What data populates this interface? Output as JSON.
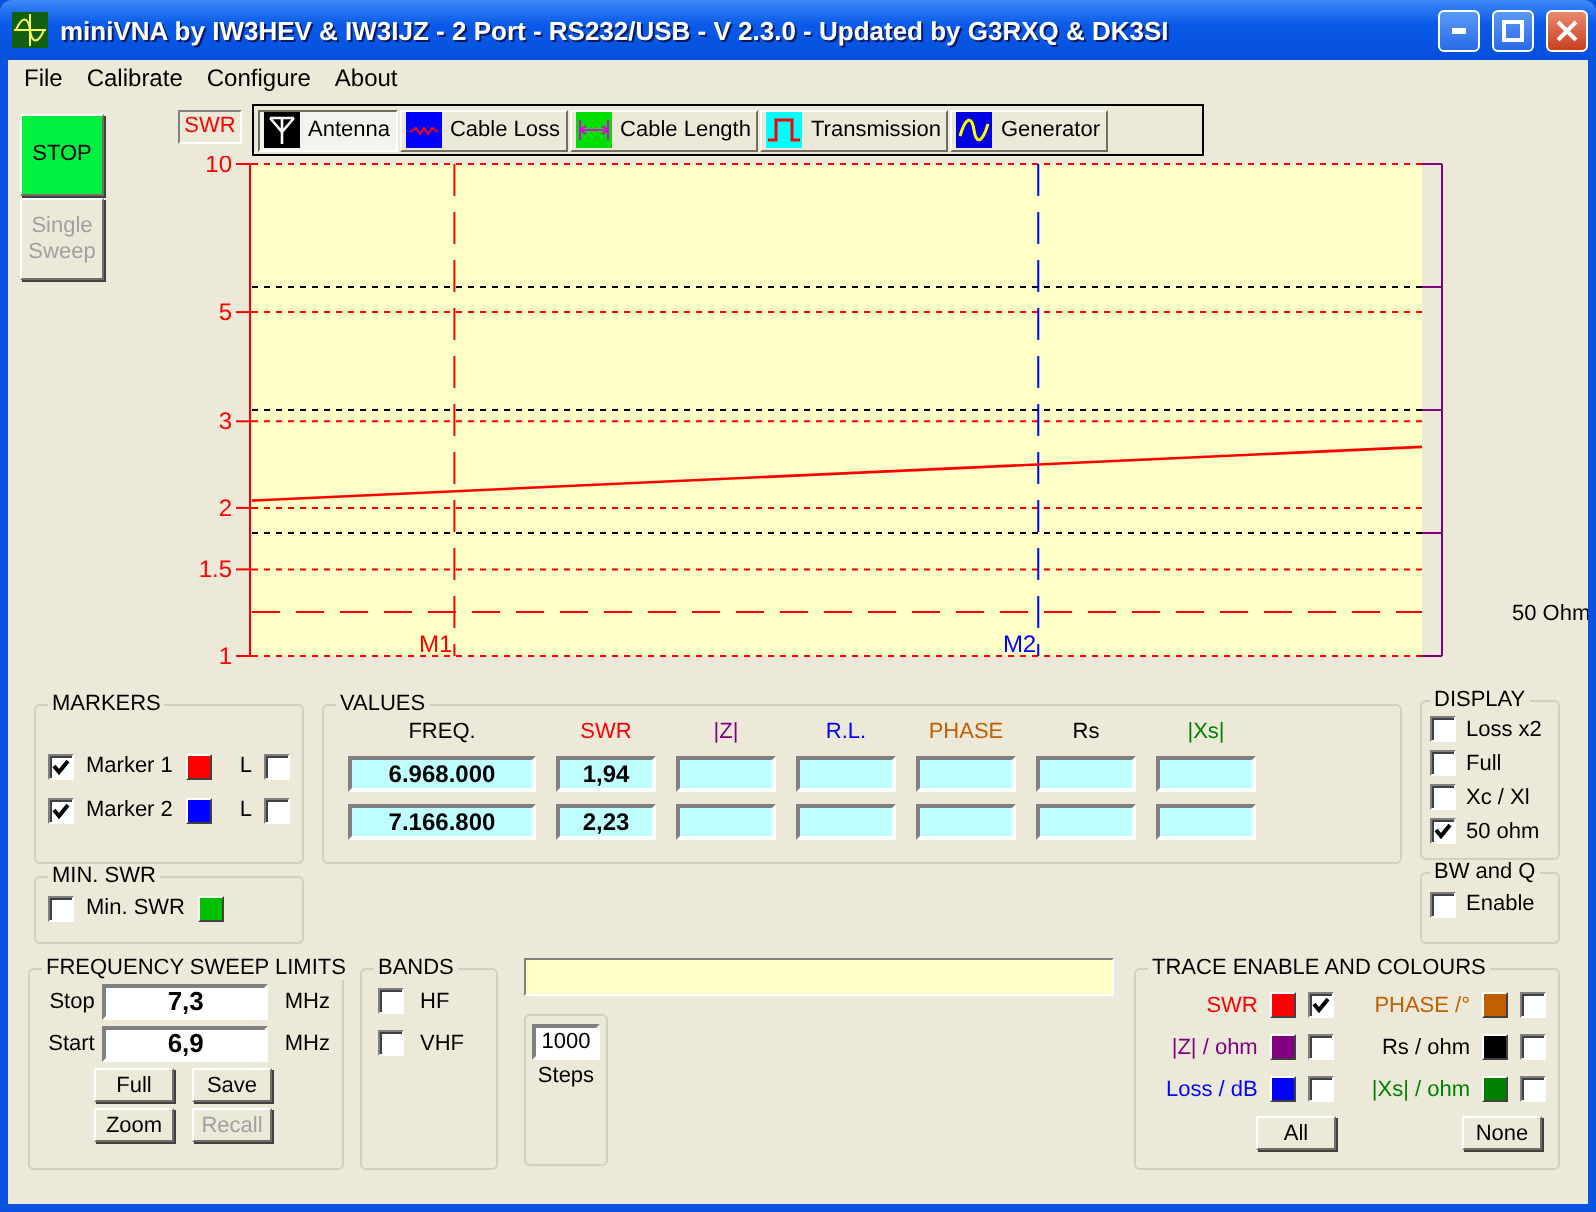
{
  "window": {
    "title": "miniVNA by IW3HEV & IW3IJZ - 2 Port - RS232/USB - V 2.3.0 - Updated by G3RXQ & DK3SI"
  },
  "menu": [
    "File",
    "Calibrate",
    "Configure",
    "About"
  ],
  "sweep_buttons": [
    {
      "label": "STOP",
      "kind": "stop",
      "disabled": false
    },
    {
      "label": "Single Sweep",
      "kind": "single",
      "disabled": true
    }
  ],
  "chart": {
    "modes": [
      {
        "label": "Antenna",
        "kind": "antenna",
        "selected": true
      },
      {
        "label": "Cable Loss",
        "kind": "loss",
        "selected": false
      },
      {
        "label": "Cable Length",
        "kind": "length",
        "selected": false
      },
      {
        "label": "Transmission",
        "kind": "transmission",
        "selected": false
      },
      {
        "label": "Generator",
        "kind": "generator",
        "selected": false
      }
    ],
    "reference_label": "50 Ohm",
    "mode_label": "SWR",
    "y_axis_labels": [
      "10",
      "5",
      "3",
      "2",
      "1.5",
      "1"
    ],
    "marker_labels": [
      "M1",
      "M2"
    ]
  },
  "markers": {
    "title": "MARKERS",
    "items": [
      {
        "label": "Marker 1",
        "checked": true,
        "color": "#ff0000",
        "lock_label": "L",
        "lock_checked": false
      },
      {
        "label": "Marker 2",
        "checked": true,
        "color": "#0000ff",
        "lock_label": "L",
        "lock_checked": false
      }
    ]
  },
  "min_swr": {
    "title": "MIN. SWR",
    "label": "Min. SWR",
    "checked": false,
    "color": "#00c000"
  },
  "values": {
    "title": "VALUES",
    "columns": [
      {
        "label": "FREQ.",
        "color": "#000000"
      },
      {
        "label": "SWR",
        "color": "#ff0000"
      },
      {
        "label": "|Z|",
        "color": "#800080"
      },
      {
        "label": "R.L.",
        "color": "#0000ff"
      },
      {
        "label": "PHASE",
        "color": "#c06000"
      },
      {
        "label": "Rs",
        "color": "#000000"
      },
      {
        "label": "|Xs|",
        "color": "#008000"
      }
    ],
    "rows": [
      {
        "cells": [
          "6.968.000",
          "1,94"
        ]
      },
      {
        "cells": [
          "7.166.800",
          "2,23"
        ]
      }
    ]
  },
  "display": {
    "title": "DISPLAY",
    "options": [
      {
        "label": "Loss x2",
        "checked": false
      },
      {
        "label": "Full",
        "checked": false
      },
      {
        "label": "Xc / Xl",
        "checked": false
      },
      {
        "label": "50 ohm",
        "checked": true
      }
    ]
  },
  "bw_q": {
    "title": "BW and Q",
    "label": "Enable",
    "checked": false
  },
  "sweep_limits": {
    "title": "FREQUENCY SWEEP LIMITS",
    "fields": [
      {
        "label": "Stop",
        "value": "7,3",
        "unit": "MHz"
      },
      {
        "label": "Start",
        "value": "6,9",
        "unit": "MHz"
      }
    ],
    "buttons": [
      {
        "label": "Full",
        "disabled": false
      },
      {
        "label": "Save",
        "disabled": false
      },
      {
        "label": "Zoom",
        "disabled": false
      },
      {
        "label": "Recall",
        "disabled": true
      }
    ]
  },
  "bands": {
    "title": "BANDS",
    "options": [
      {
        "label": "HF",
        "checked": false
      },
      {
        "label": "VHF",
        "checked": false
      }
    ]
  },
  "steps": {
    "value": "1000",
    "label": "Steps"
  },
  "traces": {
    "title": "TRACE ENABLE AND COLOURS",
    "items": [
      {
        "label": "SWR",
        "color": "#ff0000",
        "checked": true
      },
      {
        "label": "PHASE /°",
        "color": "#c06000",
        "checked": false
      },
      {
        "label": "|Z| / ohm",
        "color": "#800080",
        "checked": false
      },
      {
        "label": "Rs / ohm",
        "color": "#000000",
        "checked": false
      },
      {
        "label": "Loss / dB",
        "color": "#0000ff",
        "checked": false
      },
      {
        "label": "|Xs| / ohm",
        "color": "#008000",
        "checked": false
      }
    ],
    "buttons": [
      "All",
      "None"
    ]
  }
}
